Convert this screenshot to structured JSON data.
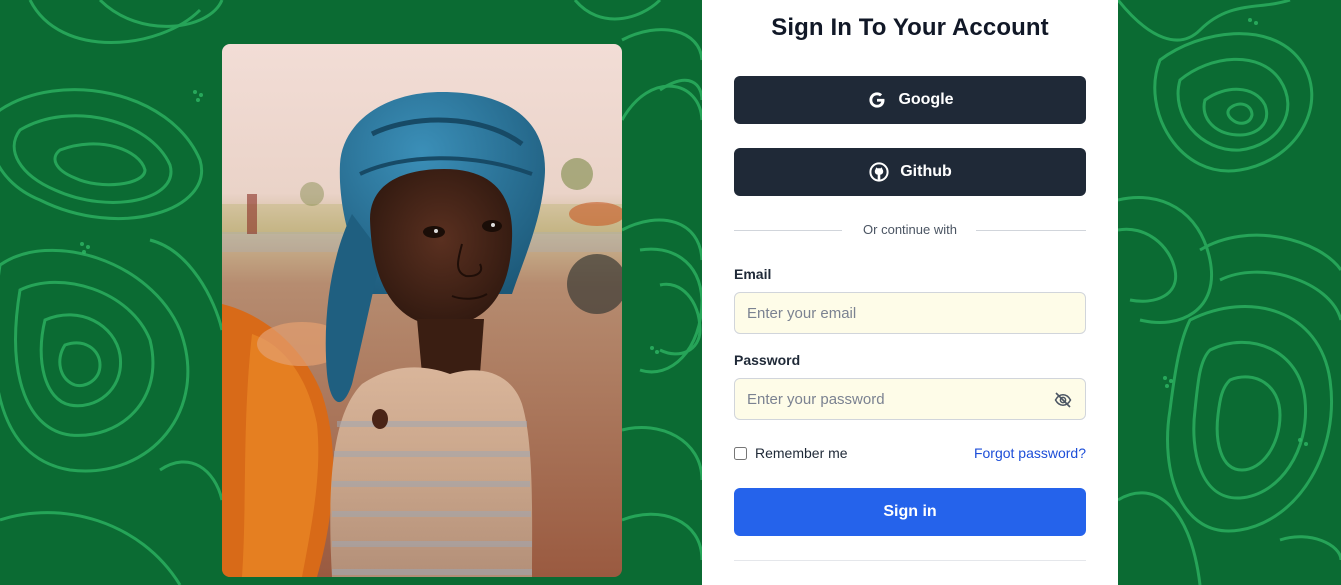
{
  "colors": {
    "background": "#0b6b33",
    "pattern_line": "#2fb865",
    "dark_button": "#1f2937",
    "primary_button": "#2563eb",
    "input_fill": "#fefce8",
    "link": "#1d4ed8"
  },
  "photo": {
    "icon": "portrait-photo"
  },
  "form": {
    "title": "Sign In To Your Account",
    "google": {
      "label": "Google",
      "icon": "google-icon"
    },
    "github": {
      "label": "Github",
      "icon": "github-icon"
    },
    "divider_text": "Or continue with",
    "email": {
      "label": "Email",
      "placeholder": "Enter your email",
      "value": ""
    },
    "password": {
      "label": "Password",
      "placeholder": "Enter your password",
      "value": "",
      "toggle_icon": "eye-off-icon"
    },
    "remember_label": "Remember me",
    "remember_checked": false,
    "forgot_label": "Forgot password?",
    "submit_label": "Sign in"
  }
}
